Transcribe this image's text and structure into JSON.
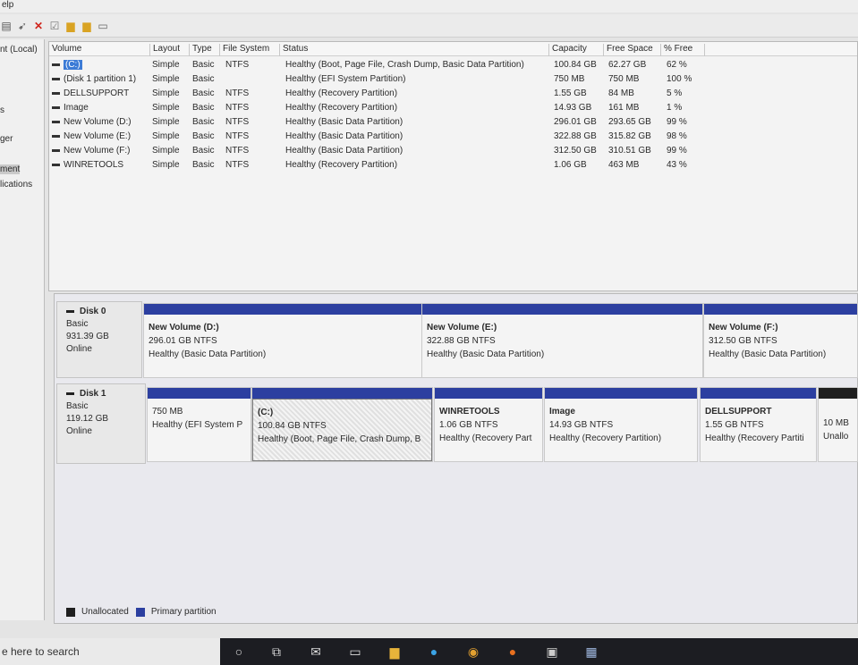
{
  "menubar": {
    "help": "elp"
  },
  "toolbar": {
    "icons": [
      "view-icon",
      "pin-icon",
      "delete-icon",
      "check-icon",
      "folder-icon",
      "folder-refresh-icon",
      "window-icon"
    ]
  },
  "tree": {
    "items": [
      "nt (Local)",
      "s",
      "ger",
      "ment",
      "lications"
    ]
  },
  "volumes": {
    "headers": [
      "Volume",
      "Layout",
      "Type",
      "File System",
      "Status",
      "Capacity",
      "Free Space",
      "% Free"
    ],
    "rows": [
      {
        "volume": "(C:)",
        "layout": "Simple",
        "type": "Basic",
        "fs": "NTFS",
        "status": "Healthy (Boot, Page File, Crash Dump, Basic Data Partition)",
        "capacity": "100.84 GB",
        "free": "62.27 GB",
        "pct": "62 %"
      },
      {
        "volume": "(Disk 1 partition 1)",
        "layout": "Simple",
        "type": "Basic",
        "fs": "",
        "status": "Healthy (EFI System Partition)",
        "capacity": "750 MB",
        "free": "750 MB",
        "pct": "100 %"
      },
      {
        "volume": "DELLSUPPORT",
        "layout": "Simple",
        "type": "Basic",
        "fs": "NTFS",
        "status": "Healthy (Recovery Partition)",
        "capacity": "1.55 GB",
        "free": "84 MB",
        "pct": "5 %"
      },
      {
        "volume": "Image",
        "layout": "Simple",
        "type": "Basic",
        "fs": "NTFS",
        "status": "Healthy (Recovery Partition)",
        "capacity": "14.93 GB",
        "free": "161 MB",
        "pct": "1 %"
      },
      {
        "volume": "New Volume (D:)",
        "layout": "Simple",
        "type": "Basic",
        "fs": "NTFS",
        "status": "Healthy (Basic Data Partition)",
        "capacity": "296.01 GB",
        "free": "293.65 GB",
        "pct": "99 %"
      },
      {
        "volume": "New Volume (E:)",
        "layout": "Simple",
        "type": "Basic",
        "fs": "NTFS",
        "status": "Healthy (Basic Data Partition)",
        "capacity": "322.88 GB",
        "free": "315.82 GB",
        "pct": "98 %"
      },
      {
        "volume": "New Volume (F:)",
        "layout": "Simple",
        "type": "Basic",
        "fs": "NTFS",
        "status": "Healthy (Basic Data Partition)",
        "capacity": "312.50 GB",
        "free": "310.51 GB",
        "pct": "99 %"
      },
      {
        "volume": "WINRETOOLS",
        "layout": "Simple",
        "type": "Basic",
        "fs": "NTFS",
        "status": "Healthy (Recovery Partition)",
        "capacity": "1.06 GB",
        "free": "463 MB",
        "pct": "43 %"
      }
    ]
  },
  "disks": [
    {
      "name": "Disk 0",
      "type": "Basic",
      "size": "931.39 GB",
      "status": "Online",
      "partitions": [
        {
          "name": "New Volume  (D:)",
          "size": "296.01 GB NTFS",
          "status": "Healthy (Basic Data Partition)"
        },
        {
          "name": "New Volume  (E:)",
          "size": "322.88 GB NTFS",
          "status": "Healthy (Basic Data Partition)"
        },
        {
          "name": "New Volume  (F:)",
          "size": "312.50 GB NTFS",
          "status": "Healthy (Basic Data Partition)"
        }
      ]
    },
    {
      "name": "Disk 1",
      "type": "Basic",
      "size": "119.12 GB",
      "status": "Online",
      "partitions": [
        {
          "name": "",
          "size": "750 MB",
          "status": "Healthy (EFI System P"
        },
        {
          "name": "(C:)",
          "size": "100.84 GB NTFS",
          "status": "Healthy (Boot, Page File, Crash Dump, B"
        },
        {
          "name": "WINRETOOLS",
          "size": "1.06 GB NTFS",
          "status": "Healthy (Recovery Part"
        },
        {
          "name": "Image",
          "size": "14.93 GB NTFS",
          "status": "Healthy (Recovery Partition)"
        },
        {
          "name": "DELLSUPPORT",
          "size": "1.55 GB NTFS",
          "status": "Healthy (Recovery Partiti"
        },
        {
          "name": "",
          "size": "10 MB",
          "status": "Unallo"
        }
      ]
    }
  ],
  "legend": {
    "unallocated": "Unallocated",
    "primary": "Primary partition",
    "unallocated_color": "#1f1f1f",
    "primary_color": "#2c3fa0"
  },
  "taskbar": {
    "search": "e here to search",
    "icons": [
      "cortana-icon",
      "task-view-icon",
      "mail-icon",
      "terminal-icon",
      "file-explorer-icon",
      "edge-icon",
      "chrome-icon",
      "firefox-icon",
      "photos-icon",
      "disk-management-icon"
    ]
  }
}
